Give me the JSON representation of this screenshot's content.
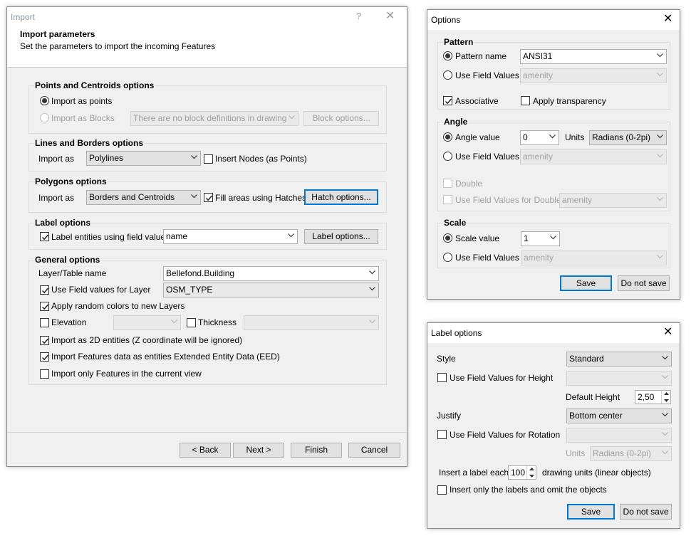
{
  "import_dialog": {
    "title": "Import",
    "help_glyph": "?",
    "close_glyph": "✕",
    "header_title": "Import parameters",
    "header_subtitle": "Set the parameters to import the incoming Features",
    "points": {
      "legend": "Points and Centroids options",
      "import_as_points": "Import as points",
      "import_as_blocks": "Import as Blocks",
      "blocks_combo": "There are no block definitions in drawing",
      "block_options": "Block options..."
    },
    "lines": {
      "legend": "Lines and Borders options",
      "import_as_label": "Import as",
      "import_as_value": "Polylines",
      "insert_nodes": "Insert Nodes (as Points)"
    },
    "polygons": {
      "legend": "Polygons options",
      "import_as_label": "Import as",
      "import_as_value": "Borders and Centroids",
      "fill_hatches": "Fill areas using Hatches",
      "hatch_options": "Hatch options..."
    },
    "labels": {
      "legend": "Label options",
      "label_entities": "Label entities using field value",
      "field_value": "name",
      "label_options": "Label options..."
    },
    "general": {
      "legend": "General options",
      "layer_label": "Layer/Table name",
      "layer_value": "Bellefond.Building",
      "use_field_layer": "Use Field values for Layer",
      "field_layer_value": "OSM_TYPE",
      "random_colors": "Apply random colors to new Layers",
      "elevation": "Elevation",
      "thickness": "Thickness",
      "import_2d": "Import as 2D entities (Z coordinate will be ignored)",
      "import_eed": "Import Features data as entities Extended Entity Data (EED)",
      "import_view": "Import only Features in the current view"
    },
    "buttons": {
      "back": "< Back",
      "next": "Next >",
      "finish": "Finish",
      "cancel": "Cancel"
    }
  },
  "options_dialog": {
    "title": "Options",
    "close_glyph": "✕",
    "pattern": {
      "legend": "Pattern",
      "pattern_name": "Pattern name",
      "pattern_value": "ANSI31",
      "use_field_values": "Use Field Values",
      "field_value": "amenity",
      "associative": "Associative",
      "apply_transparency": "Apply transparency"
    },
    "angle": {
      "legend": "Angle",
      "angle_value": "Angle value",
      "angle_input": "0",
      "units_label": "Units",
      "units_value": "Radians (0-2pi)",
      "use_field_values": "Use Field Values",
      "field_value": "amenity",
      "double": "Double",
      "use_field_double": "Use Field Values for Double",
      "double_field_value": "amenity"
    },
    "scale": {
      "legend": "Scale",
      "scale_value": "Scale value",
      "scale_input": "1",
      "use_field_values": "Use Field Values",
      "field_value": "amenity"
    },
    "buttons": {
      "save": "Save",
      "do_not_save": "Do not save"
    }
  },
  "label_dialog": {
    "title": "Label options",
    "close_glyph": "✕",
    "style_label": "Style",
    "style_value": "Standard",
    "use_field_height": "Use Field Values for Height",
    "default_height_label": "Default Height",
    "default_height_value": "2,50",
    "justify_label": "Justify",
    "justify_value": "Bottom center",
    "use_field_rotation": "Use Field Values for Rotation",
    "units_label": "Units",
    "units_value": "Radians (0-2pi)",
    "insert_each_prefix": "Insert a label each",
    "insert_each_value": "100",
    "insert_each_suffix": "drawing units (linear objects)",
    "insert_only_labels": "Insert only the labels and omit the objects",
    "buttons": {
      "save": "Save",
      "do_not_save": "Do not save"
    }
  },
  "colors": {
    "accent": "#0078d7",
    "dialog_bg": "#f0f0f0",
    "disabled_text": "#a0a0a0"
  }
}
